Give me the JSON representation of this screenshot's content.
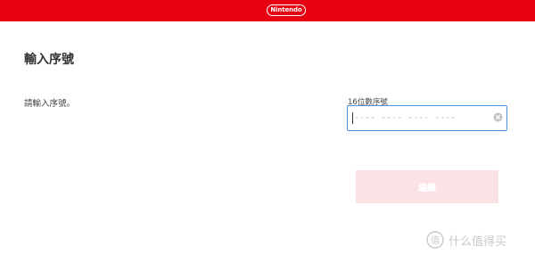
{
  "header": {
    "brand": "Nintendo",
    "brand_color": "#e60012"
  },
  "page": {
    "title": "輸入序號"
  },
  "form": {
    "instruction": "請輸入序號。",
    "code_label": "16位數序號",
    "code_value": "",
    "code_placeholder": "---- ---- ---- ----",
    "submit_label": "繼續",
    "submit_state": "disabled"
  },
  "watermark": {
    "logo": "值",
    "text": "什么值得买"
  },
  "icons": {
    "clear": "clear-circle-icon"
  }
}
